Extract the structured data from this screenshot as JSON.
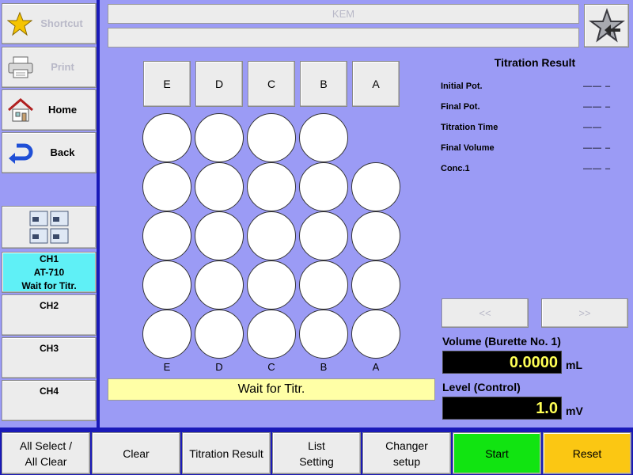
{
  "sidebar": {
    "shortcut_label": "Shortcut",
    "print_label": "Print",
    "home_label": "Home",
    "back_label": "Back",
    "channels": [
      {
        "lines": [
          "CH1",
          "AT-710",
          "Wait for Titr."
        ]
      },
      {
        "lines": [
          "CH2"
        ]
      },
      {
        "lines": [
          "CH3"
        ]
      },
      {
        "lines": [
          "CH4"
        ]
      }
    ]
  },
  "header": {
    "title": "KEM",
    "subtitle": ""
  },
  "changer": {
    "columns": [
      "E",
      "D",
      "C",
      "B",
      "A"
    ],
    "status": "Wait for Titr."
  },
  "result": {
    "title": "Titration Result",
    "rows": [
      {
        "label": "Initial Pot.",
        "value": "—— –"
      },
      {
        "label": "Final Pot.",
        "value": "—— –"
      },
      {
        "label": "Titration Time",
        "value": "——"
      },
      {
        "label": "Final Volume",
        "value": "—— –"
      },
      {
        "label": "Conc.1",
        "value": "—— –"
      }
    ],
    "prev_label": "<<",
    "next_label": ">>"
  },
  "readouts": {
    "volume_label": "Volume (Burette No. 1)",
    "volume_value": "0.0000",
    "volume_unit": "mL",
    "level_label": "Level (Control)",
    "level_value": "1.0",
    "level_unit": "mV"
  },
  "footer": {
    "all_select_line1": "All Select /",
    "all_select_line2": "All Clear",
    "clear_label": "Clear",
    "titration_result_label": "Titration Result",
    "list_setting_line1": "List",
    "list_setting_line2": "Setting",
    "changer_setup_line1": "Changer",
    "changer_setup_line2": "setup",
    "start_label": "Start",
    "reset_label": "Reset"
  },
  "colors": {
    "background": "#9b9bf5",
    "frame": "#1a1ab8",
    "active_channel": "#5ff0f6",
    "status_bar": "#ffffa6",
    "start": "#11e411",
    "reset": "#fbc713",
    "lcd_text": "#ffff55"
  },
  "icons": {
    "shortcut": "star-icon",
    "print": "printer-icon",
    "home": "house-icon",
    "back": "back-arrow-icon",
    "channel_grid": "four-channel-icon",
    "favorite": "star-arrow-icon"
  }
}
